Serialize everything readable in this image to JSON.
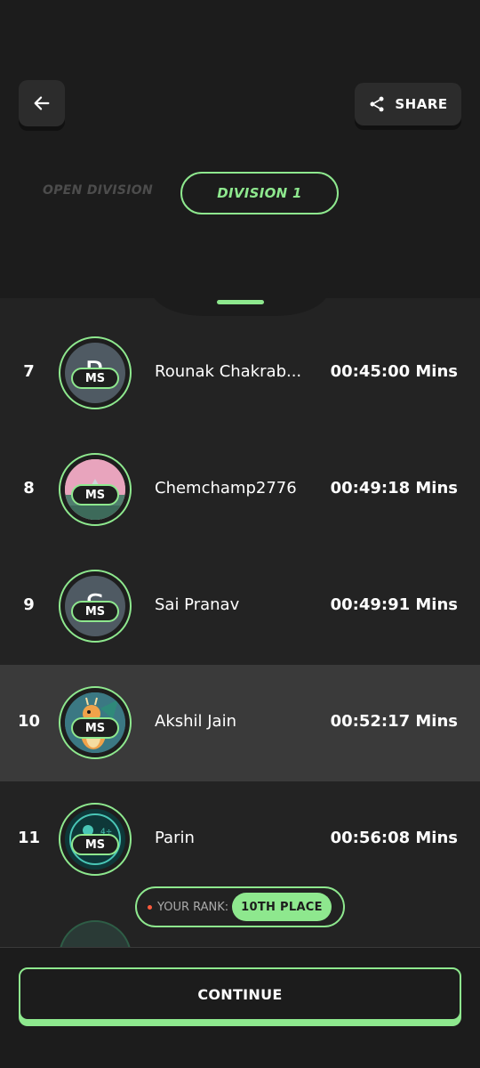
{
  "header": {
    "share_label": "SHARE",
    "tabs": [
      "OPEN DIVISION",
      "DIVISION 1"
    ],
    "active_tab": "DIVISION 1"
  },
  "leaderboard": [
    {
      "rank": "7",
      "name": "Rounak Chakrab...",
      "time": "00:45:00 Mins",
      "avatar": "letter",
      "letter": "R",
      "badge": "MS"
    },
    {
      "rank": "8",
      "name": "Chemchamp2776",
      "time": "00:49:18 Mins",
      "avatar": "castle-image",
      "badge": "MS"
    },
    {
      "rank": "9",
      "name": "Sai Pranav",
      "time": "00:49:91 Mins",
      "avatar": "letter",
      "letter": "S",
      "badge": "MS"
    },
    {
      "rank": "10",
      "name": "Akshil Jain",
      "time": "00:52:17 Mins",
      "avatar": "dragon-image",
      "badge": "MS",
      "highlighted": true
    },
    {
      "rank": "11",
      "name": "Parin",
      "time": "00:56:08 Mins",
      "avatar": "ninja-image",
      "badge": "MS"
    }
  ],
  "your_rank": {
    "label": "YOUR RANK:",
    "value": "10TH PLACE"
  },
  "footer": {
    "continue_label": "CONTINUE"
  },
  "colors": {
    "accent": "#8ee88e",
    "background": "#232323",
    "header": "#1c1c1c",
    "highlight": "#3a3a3a"
  }
}
